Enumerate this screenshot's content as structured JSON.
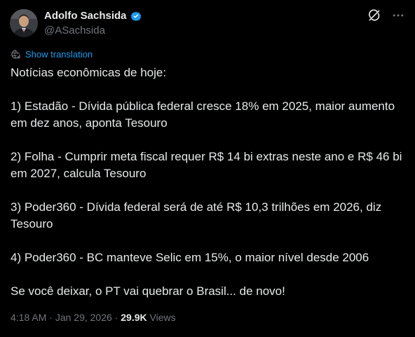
{
  "author": {
    "display_name": "Adolfo Sachsida",
    "handle": "@ASachsida",
    "verified": true
  },
  "actions": {
    "grok_icon": "grok-icon",
    "more_icon": "more-icon"
  },
  "translate": {
    "label": "Show translation"
  },
  "post": {
    "intro": "Notícias econômicas de hoje:",
    "items": [
      "1) Estadão - Dívida pública federal cresce 18% em 2025, maior aumento em dez anos, aponta Tesouro",
      "2) Folha - Cumprir meta fiscal requer R$ 14 bi extras neste ano e R$ 46 bi em 2027, calcula Tesouro",
      "3) Poder360 - Dívida federal será de até R$ 10,3 trilhões em 2026, diz Tesouro",
      "4) Poder360 - BC manteve Selic em 15%, o maior nível desde 2006"
    ],
    "closing": "Se você deixar, o PT vai quebrar o Brasil... de novo!"
  },
  "meta": {
    "time": "4:18 AM",
    "separator": " · ",
    "date": "Jan 29, 2026",
    "views_count": "29.9K",
    "views_label": " Views"
  },
  "colors": {
    "background": "#000000",
    "text": "#e7e9ea",
    "secondary": "#71767b",
    "accent": "#1d9bf0"
  }
}
